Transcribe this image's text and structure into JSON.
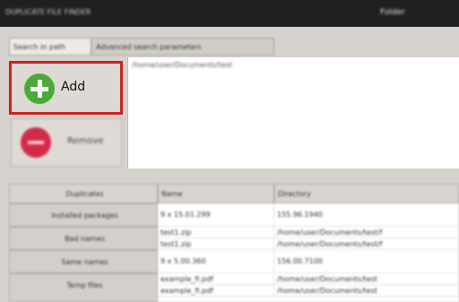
{
  "window": {
    "title_left": "DUPLICATE FILE FINDER",
    "title_right": "Folder"
  },
  "tabs": [
    {
      "label": "Search in path"
    },
    {
      "label": "Advanced search parameters"
    }
  ],
  "buttons": {
    "add_label": "Add",
    "remove_label": "Remove"
  },
  "path_list": {
    "entries": [
      "/home/user/Documents/test"
    ]
  },
  "results": {
    "headers": {
      "corner": "Duplicates",
      "name": "Name",
      "directory": "Directory"
    },
    "row_labels": [
      "Installed packages",
      "Bad names",
      "Same names",
      "Temp files"
    ],
    "rows": [
      {
        "name": "9 x 15.01.299",
        "directory": "155.96.1940"
      },
      {
        "name": "test1.zip",
        "directory": "/home/user/Documents/test/f"
      },
      {
        "name": "test1.zip",
        "directory": "/home/user/Documents/test/f"
      },
      {
        "name": "9 x 5.00.360",
        "directory": "156.00.7100"
      },
      {
        "name": "example_fi.pdf",
        "directory": "/home/user/Documents/test"
      },
      {
        "name": "example_fi.pdf",
        "directory": "/home/user/Documents/test"
      }
    ]
  }
}
